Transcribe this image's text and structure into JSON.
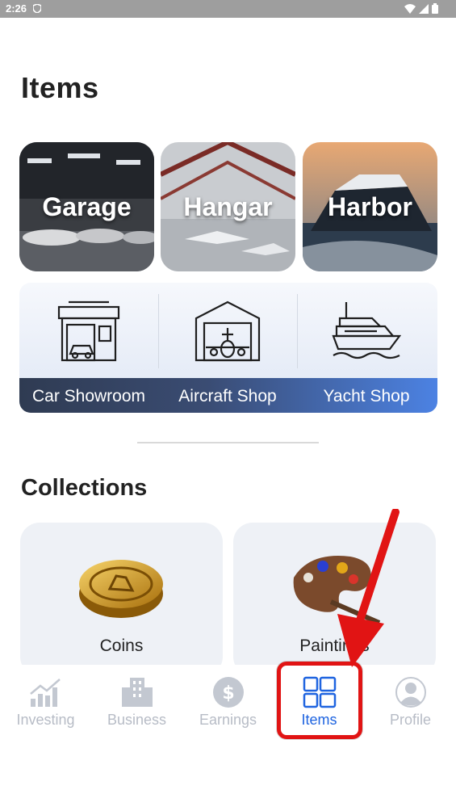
{
  "status_bar": {
    "time": "2:26"
  },
  "page_title": "Items",
  "categories": [
    {
      "label": "Garage"
    },
    {
      "label": "Hangar"
    },
    {
      "label": "Harbor"
    }
  ],
  "shops": [
    {
      "label": "Car Showroom",
      "icon": "car-showroom-icon"
    },
    {
      "label": "Aircraft Shop",
      "icon": "aircraft-hangar-icon"
    },
    {
      "label": "Yacht Shop",
      "icon": "yacht-icon"
    }
  ],
  "collections": {
    "title": "Collections",
    "items": [
      {
        "label": "Coins",
        "icon": "gold-coin-icon"
      },
      {
        "label": "Paintings",
        "icon": "paint-palette-icon"
      }
    ]
  },
  "tab_bar": {
    "tabs": [
      {
        "label": "Investing",
        "icon": "chart-icon"
      },
      {
        "label": "Business",
        "icon": "building-icon"
      },
      {
        "label": "Earnings",
        "icon": "dollar-icon"
      },
      {
        "label": "Items",
        "icon": "grid-icon",
        "active": true
      },
      {
        "label": "Profile",
        "icon": "avatar-icon"
      }
    ]
  },
  "colors": {
    "accent": "#1f64e0",
    "inactive": "#b7bcc6",
    "annotation": "#e11414"
  }
}
